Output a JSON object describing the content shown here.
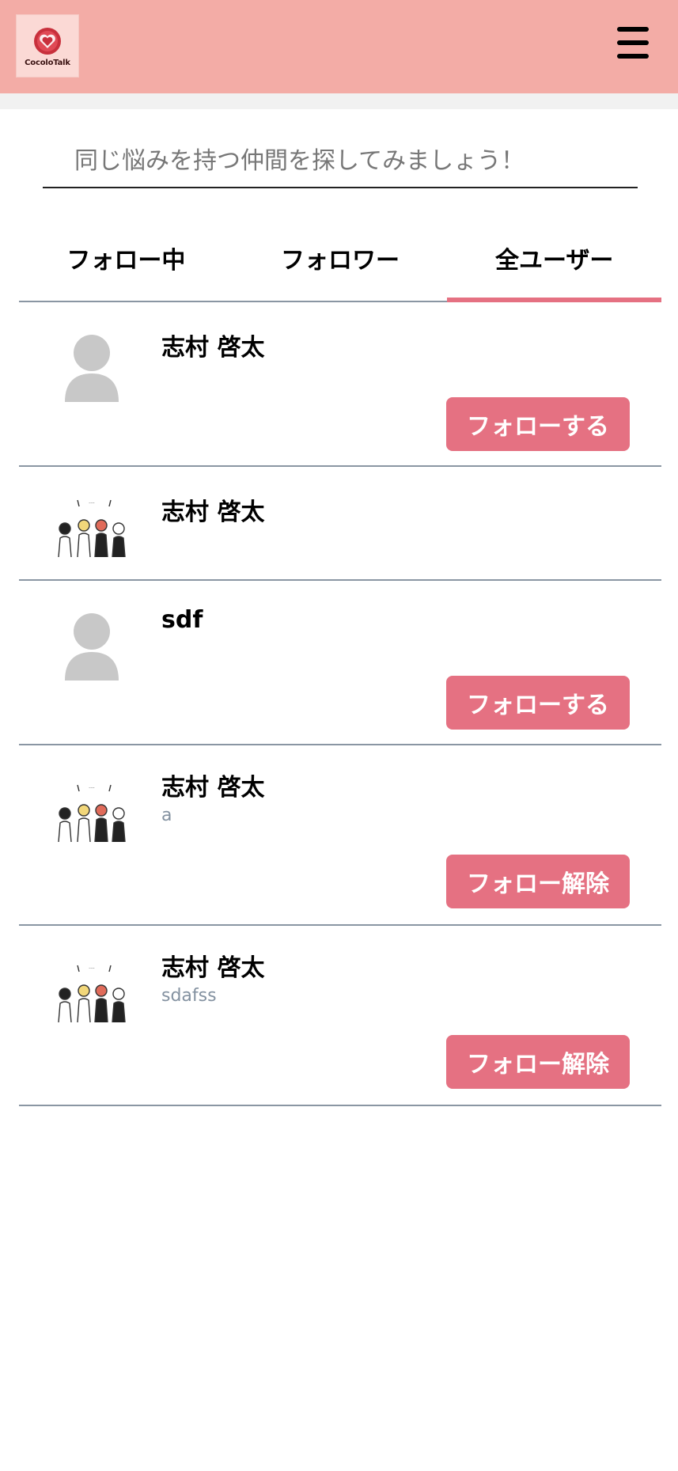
{
  "header": {
    "logo_text": "CocoloTalk",
    "brand_color": "#f3aca6",
    "menu_icon": "hamburger-menu-icon"
  },
  "search": {
    "placeholder": "同じ悩みを持つ仲間を探してみましょう！"
  },
  "tabs": [
    {
      "label": "フォロー中",
      "active": false
    },
    {
      "label": "フォロワー",
      "active": false
    },
    {
      "label": "全ユーザー",
      "active": true
    }
  ],
  "accent_color": "#e57182",
  "users": [
    {
      "name": "志村 啓太",
      "bio": "",
      "avatar": "default-avatar-icon",
      "button": "フォローする"
    },
    {
      "name": "志村 啓太",
      "bio": "",
      "avatar": "group-illustration-avatar",
      "button": ""
    },
    {
      "name": "sdf",
      "bio": "",
      "avatar": "default-avatar-icon",
      "button": "フォローする"
    },
    {
      "name": "志村 啓太",
      "bio": "a",
      "avatar": "group-illustration-avatar",
      "button": "フォロー解除"
    },
    {
      "name": "志村 啓太",
      "bio": "sdafss",
      "avatar": "group-illustration-avatar",
      "button": "フォロー解除"
    }
  ]
}
